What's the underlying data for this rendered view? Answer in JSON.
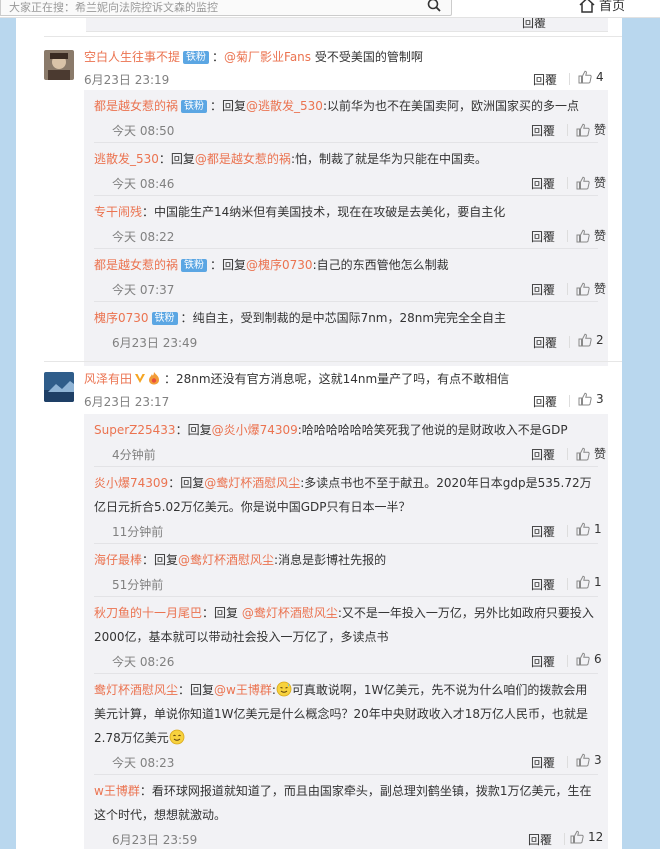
{
  "search": {
    "placeholder": "大家正在搜：希兰妮向法院控诉文森的监控"
  },
  "header": {
    "home_label": "首页"
  },
  "prev_thread": {
    "reply_label": "回覆"
  },
  "threads": [
    {
      "author": "空白人生往事不提",
      "badge": "铁粉",
      "mention": "@菊厂影业Fans",
      "text": " 受不受美国的管制啊",
      "time": "6月23日 23:19",
      "reply_label": "回覆",
      "likes": "4",
      "replies": [
        {
          "author": "都是越女惹的祸",
          "badge": "铁粉",
          "prefix": "：回复",
          "mention": "@逃散发_530",
          "text": ":以前华为也不在美国卖阿，欧洲国家买的多一点",
          "time": "今天 08:50",
          "reply_label": "回覆",
          "likes": "赞"
        },
        {
          "author": "逃散发_530",
          "badge": "",
          "prefix": "：回复",
          "mention": "@都是越女惹的祸",
          "text": ":怕，制裁了就是华为只能在中国卖。",
          "time": "今天 08:46",
          "reply_label": "回覆",
          "likes": "赞"
        },
        {
          "author": "专干闹残",
          "badge": "",
          "prefix": "：",
          "mention": "",
          "text": "中国能生产14纳米但有美国技术，现在在攻破是去美化，要自主化",
          "time": "今天 08:22",
          "reply_label": "回覆",
          "likes": "赞"
        },
        {
          "author": "都是越女惹的祸",
          "badge": "铁粉",
          "prefix": "：回复",
          "mention": "@槐序0730",
          "text": ":自己的东西管他怎么制裁",
          "time": "今天 07:37",
          "reply_label": "回覆",
          "likes": "赞"
        },
        {
          "author": "槐序0730",
          "badge": "铁粉",
          "prefix": "：",
          "mention": "",
          "text": "纯自主，受到制裁的是中芯国际7nm，28nm完完全全自主",
          "time": "6月23日 23:49",
          "reply_label": "回覆",
          "likes": "2"
        }
      ]
    },
    {
      "author": "风泽有田",
      "badge": "",
      "mention": "",
      "text": "：28nm还没有官方消息呢，这就14nm量产了吗，有点不敢相信",
      "time": "6月23日 23:17",
      "reply_label": "回覆",
      "likes": "3",
      "replies": [
        {
          "author": "SuperZ25433",
          "badge": "",
          "prefix": "：回复",
          "mention": "@炎小爆74309",
          "text": ":哈哈哈哈哈哈笑死我了他说的是财政收入不是GDP",
          "time": "4分钟前",
          "reply_label": "回覆",
          "likes": "赞"
        },
        {
          "author": "炎小爆74309",
          "badge": "",
          "prefix": "：回复",
          "mention": "@鸯灯杯酒慰风尘",
          "text": ":多读点书也不至于献丑。2020年日本gdp是535.72万亿日元折合5.02万亿美元。你是说中国GDP只有日本一半？",
          "time": "11分钟前",
          "reply_label": "回覆",
          "likes": "1"
        },
        {
          "author": "海仔最棒",
          "badge": "",
          "prefix": "：回复",
          "mention": "@鸯灯杯酒慰风尘",
          "text": ":消息是彭博社先报的",
          "time": "51分钟前",
          "reply_label": "回覆",
          "likes": "1"
        },
        {
          "author": "秋刀鱼的十一月尾巴",
          "badge": "",
          "prefix": "：回复 ",
          "mention": "@鸯灯杯酒慰风尘",
          "text": ":又不是一年投入一万亿，另外比如政府只要投入2000亿，基本就可以带动社会投入一万亿了，多读点书",
          "time": "今天 08:26",
          "reply_label": "回覆",
          "likes": "6"
        },
        {
          "author": "鸯灯杯酒慰风尘",
          "badge": "",
          "prefix": "：回复",
          "mention": "@w王博群",
          "text_a": ":",
          "text_b": "可真敢说啊，1W亿美元，先不说为什么咱们的拨款会用美元计算，单说你知道1W亿美元是什么概念吗？20年中央财政收入才18万亿人民币，也就是2.78万亿美元",
          "time": "今天 08:23",
          "reply_label": "回覆",
          "likes": "3"
        },
        {
          "author": "w王博群",
          "badge": "",
          "prefix": "：",
          "mention": "",
          "text": "看环球网报道就知道了，而且由国家牵头，副总理刘鹤坐镇，拨款1万亿美元，生在这个时代，想想就激动。",
          "time": "6月23日 23:59",
          "reply_label": "回覆",
          "likes": "12"
        }
      ]
    }
  ],
  "icons": {
    "like": "thumb-up-icon",
    "search": "search-icon",
    "home": "home-icon"
  },
  "colors": {
    "name": "#eb7350",
    "badge": "#5ba6e3",
    "background": "#b9d7ee"
  }
}
